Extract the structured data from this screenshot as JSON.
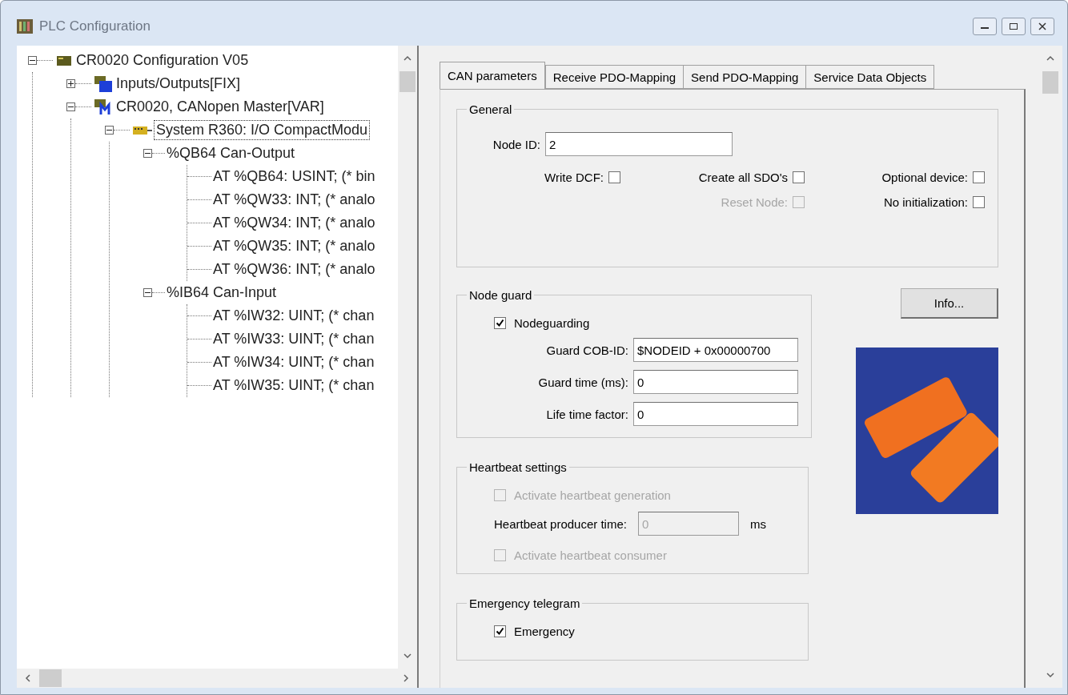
{
  "window": {
    "title": "PLC Configuration"
  },
  "tree": [
    {
      "label": "CR0020 Configuration V05",
      "kind": "config",
      "expanded": true,
      "selected": false,
      "children": [
        {
          "label": "Inputs/Outputs[FIX]",
          "kind": "io",
          "expanded": false,
          "selected": false
        },
        {
          "label": "CR0020, CANopen Master[VAR]",
          "kind": "master",
          "expanded": true,
          "selected": false,
          "children": [
            {
              "label": "System R360: I/O CompactModu",
              "kind": "module",
              "expanded": true,
              "selected": true,
              "children": [
                {
                  "label": "%QB64 Can-Output",
                  "kind": "none",
                  "expanded": true,
                  "selected": false,
                  "children": [
                    {
                      "label": "AT %QB64: USINT; (* bin",
                      "kind": "leaf",
                      "selected": false
                    },
                    {
                      "label": "AT %QW33: INT; (* analo",
                      "kind": "leaf",
                      "selected": false
                    },
                    {
                      "label": "AT %QW34: INT; (* analo",
                      "kind": "leaf",
                      "selected": false
                    },
                    {
                      "label": "AT %QW35: INT; (* analo",
                      "kind": "leaf",
                      "selected": false
                    },
                    {
                      "label": "AT %QW36: INT; (* analo",
                      "kind": "leaf",
                      "selected": false
                    }
                  ]
                },
                {
                  "label": "%IB64 Can-Input",
                  "kind": "none",
                  "expanded": true,
                  "selected": false,
                  "children": [
                    {
                      "label": "AT %IW32: UINT; (* chan",
                      "kind": "leaf",
                      "selected": false
                    },
                    {
                      "label": "AT %IW33: UINT; (* chan",
                      "kind": "leaf",
                      "selected": false
                    },
                    {
                      "label": "AT %IW34: UINT; (* chan",
                      "kind": "leaf",
                      "selected": false
                    },
                    {
                      "label": "AT %IW35: UINT; (* chan",
                      "kind": "leaf",
                      "selected": false
                    }
                  ]
                }
              ]
            }
          ]
        }
      ]
    }
  ],
  "tabs": [
    {
      "label": "CAN parameters",
      "selected": true
    },
    {
      "label": "Receive PDO-Mapping",
      "selected": false
    },
    {
      "label": "Send PDO-Mapping",
      "selected": false
    },
    {
      "label": "Service Data Objects",
      "selected": false
    }
  ],
  "general": {
    "title": "General",
    "node_id": {
      "label": "Node ID:",
      "value": "2"
    },
    "option_rows": [
      [
        {
          "label": "Write DCF:",
          "checked": false,
          "disabled": false
        },
        {
          "label": "Create all SDO's",
          "checked": false,
          "disabled": false
        },
        {
          "label": "Optional device:",
          "checked": false,
          "disabled": false
        }
      ],
      [
        {
          "label": "Reset Node:",
          "checked": false,
          "disabled": true
        },
        {
          "label": "No initialization:",
          "checked": false,
          "disabled": false
        }
      ]
    ]
  },
  "node_guard": {
    "title": "Node guard",
    "nodeguarding": {
      "label": "Nodeguarding",
      "checked": true
    },
    "fields": [
      {
        "label": "Guard COB-ID:",
        "value": "$NODEID + 0x00000700"
      },
      {
        "label": "Guard time (ms):",
        "value": "0"
      },
      {
        "label": "Life time factor:",
        "value": "0"
      }
    ]
  },
  "info_button": "Info...",
  "heartbeat": {
    "title": "Heartbeat settings",
    "generation": {
      "label": "Activate heartbeat generation",
      "checked": false,
      "disabled": true
    },
    "producer_time": {
      "label": "Heartbeat producer time:",
      "value": "0",
      "unit": "ms",
      "disabled": true
    },
    "consumer": {
      "label": "Activate heartbeat consumer",
      "checked": false,
      "disabled": true
    }
  },
  "emergency": {
    "title": "Emergency telegram",
    "emergency": {
      "label": "Emergency",
      "checked": true
    }
  }
}
